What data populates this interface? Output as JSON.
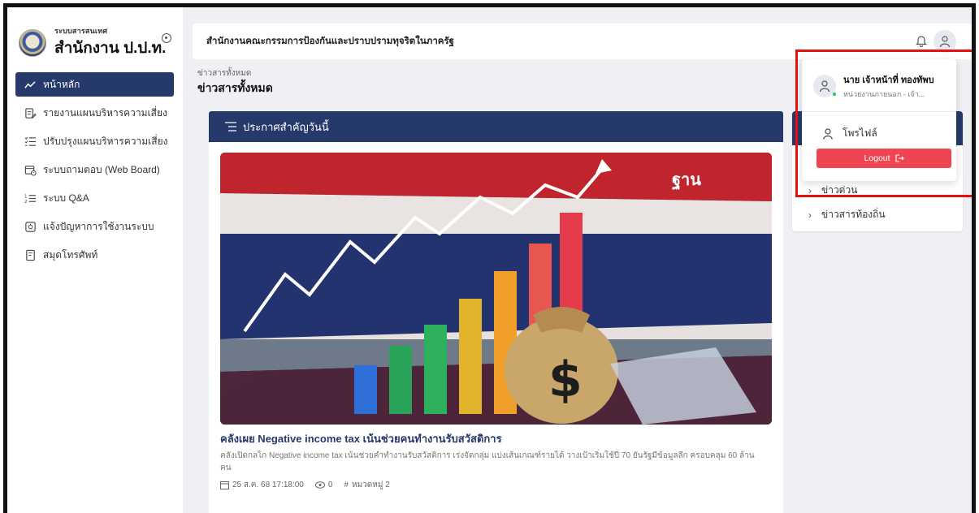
{
  "brand": {
    "subtitle": "ระบบสารสนเทศ",
    "title": "สำนักงาน ป.ป.ท."
  },
  "sidebar": {
    "items": [
      {
        "label": "หน้าหลัก",
        "icon": "trend-line-icon",
        "active": true
      },
      {
        "label": "รายงานแผนบริหารความเสี่ยง",
        "icon": "report-edit-icon"
      },
      {
        "label": "ปรับปรุงแผนบริหารความเสี่ยง",
        "icon": "checklist-icon"
      },
      {
        "label": "ระบบถามตอบ (Web Board)",
        "icon": "board-clock-icon"
      },
      {
        "label": "ระบบ Q&A",
        "icon": "qa-list-icon"
      },
      {
        "label": "แจ้งปัญหาการใช้งานระบบ",
        "icon": "report-problem-icon"
      },
      {
        "label": "สมุดโทรศัพท์",
        "icon": "phone-book-icon"
      }
    ]
  },
  "topbar": {
    "title": "สำนักงานคณะกรรมการป้องกันและปราบปรามทุจริตในภาครัฐ"
  },
  "breadcrumb": {
    "small": "ข่าวสารทั้งหมด",
    "title": "ข่าวสารทั้งหมด"
  },
  "announcement": {
    "header": "ประกาศสำคัญวันนี้",
    "watermark": "ฐาน",
    "news_title": "คลังเผย Negative income tax เน้นช่วยคนทำงานรับสวัสดิการ",
    "news_desc": "คลังเปิดกลไก Negative income tax เน้นช่วยคำทำงานรับสวัสดิการ เร่งจัดกลุ่ม แบ่งเส้นเกณฑ์รายได้ วางเป้าเริ่มใช้ปี 70 ยันรัฐมีข้อมูลลึก ครอบคลุม 60 ล้านคน",
    "date": "25 ส.ค. 68 17:18:00",
    "views": "0",
    "category": "หมวดหมู่ 2"
  },
  "side_panel": {
    "links": [
      "ข่าวด่วน",
      "ข่าวสารท้องถิ่น"
    ]
  },
  "user_menu": {
    "name": "นาย เจ้าหน้าที่ ทองทัพบ",
    "org": "หน่วยงานภายนอก - เจ้า...",
    "profile_label": "โพรไฟล์",
    "logout_label": "Logout",
    "online_color": "#22c55e"
  },
  "colors": {
    "primary": "#253a6b",
    "logout": "#ef4452",
    "highlight": "#e31212"
  }
}
